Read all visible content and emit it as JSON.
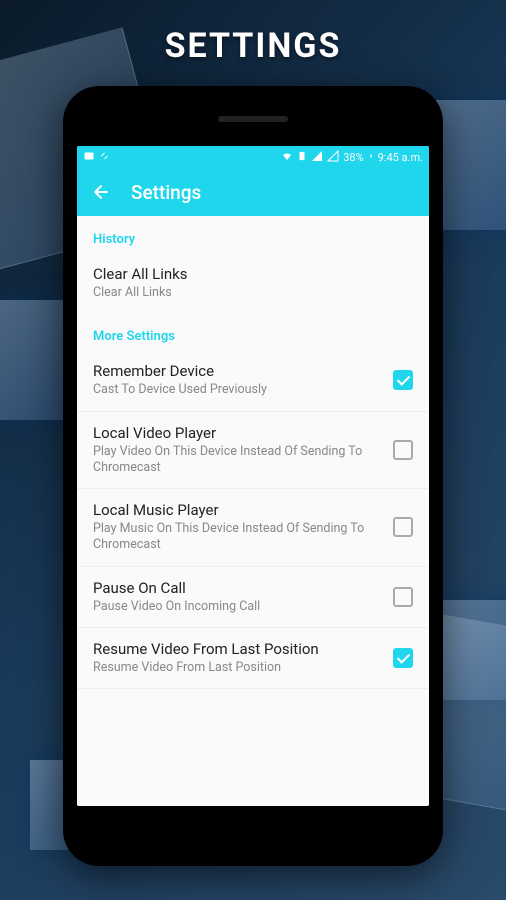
{
  "page_heading": "SETTINGS",
  "statusbar": {
    "battery": "38%",
    "time": "9:45 a.m."
  },
  "appbar": {
    "title": "Settings"
  },
  "sections": {
    "history": {
      "header": "History",
      "clear_links": {
        "title": "Clear All Links",
        "subtitle": "Clear All Links"
      }
    },
    "more": {
      "header": "More Settings",
      "remember_device": {
        "title": "Remember Device",
        "subtitle": "Cast To Device Used Previously",
        "checked": true
      },
      "local_video": {
        "title": "Local Video Player",
        "subtitle": "Play Video On This Device Instead Of Sending To Chromecast",
        "checked": false
      },
      "local_music": {
        "title": "Local Music Player",
        "subtitle": "Play Music On This Device Instead Of Sending To Chromecast",
        "checked": false
      },
      "pause_call": {
        "title": "Pause On Call",
        "subtitle": "Pause Video On Incoming Call",
        "checked": false
      },
      "resume_video": {
        "title": "Resume Video From Last Position",
        "subtitle": "Resume Video From Last Position",
        "checked": true
      }
    }
  }
}
